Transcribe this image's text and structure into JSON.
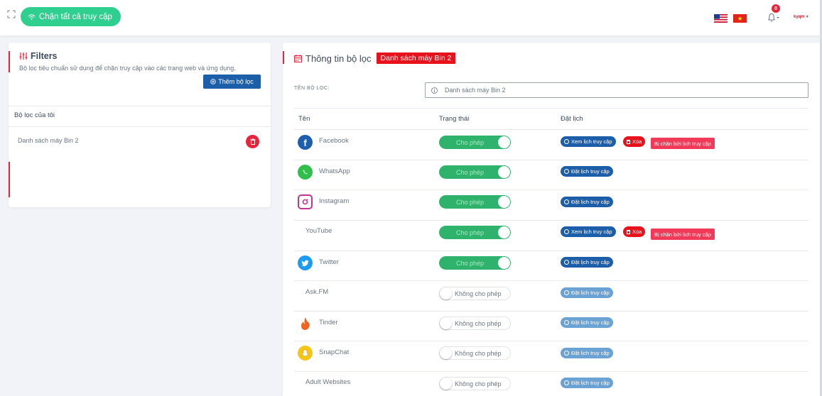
{
  "header": {
    "block_all_label": "Chặn tất cả truy cập",
    "notification_count": "0",
    "logo_text": "kyqm"
  },
  "filters": {
    "title": "Filters",
    "description": "Bộ lọc tiêu chuẩn sử dụng để chặn truy cập vào các trang web và ứng dụng.",
    "add_button": "Thêm bộ lọc",
    "my_filters_label": "Bộ lọc của tôi",
    "items": [
      {
        "name": "Danh sách máy Bin 2"
      }
    ]
  },
  "info": {
    "title": "Thông tin bộ lọc",
    "tag": "Danh sách máy Bin 2",
    "name_label": "TÊN BỘ LỌC:",
    "name_value": "Danh sách máy Bin 2",
    "columns": {
      "name": "Tên",
      "status": "Trạng thái",
      "schedule": "Đặt lịch"
    }
  },
  "labels": {
    "allow": "Cho phép",
    "deny": "Không cho phép",
    "view_schedule": "Xem lịch truy cập",
    "set_schedule": "Đặt lịch truy cập",
    "delete": "Xóa",
    "blocked_by_schedule": "Bị chặn bởi lịch truy cập"
  },
  "apps": [
    {
      "name": "Facebook",
      "icon": "facebook-icon",
      "allowed": true,
      "scheduled": true
    },
    {
      "name": "WhatsApp",
      "icon": "whatsapp-icon",
      "allowed": true,
      "scheduled": false
    },
    {
      "name": "Instagram",
      "icon": "instagram-icon",
      "allowed": true,
      "scheduled": false
    },
    {
      "name": "YouTube",
      "icon": "",
      "allowed": true,
      "scheduled": true
    },
    {
      "name": "Twitter",
      "icon": "twitter-icon",
      "allowed": true,
      "scheduled": false
    },
    {
      "name": "Ask.FM",
      "icon": "",
      "allowed": false,
      "scheduled": false
    },
    {
      "name": "Tinder",
      "icon": "tinder-icon",
      "allowed": false,
      "scheduled": false
    },
    {
      "name": "SnapChat",
      "icon": "snapchat-icon",
      "allowed": false,
      "scheduled": false
    },
    {
      "name": "Adult Websites",
      "icon": "",
      "allowed": false,
      "scheduled": false
    }
  ],
  "colors": {
    "accent_green": "#2ecf8f",
    "toggle_on": "#2fb36c",
    "primary_blue": "#1c5fa8",
    "danger_red": "#e8121c",
    "blocked_pink": "#f03a57"
  }
}
